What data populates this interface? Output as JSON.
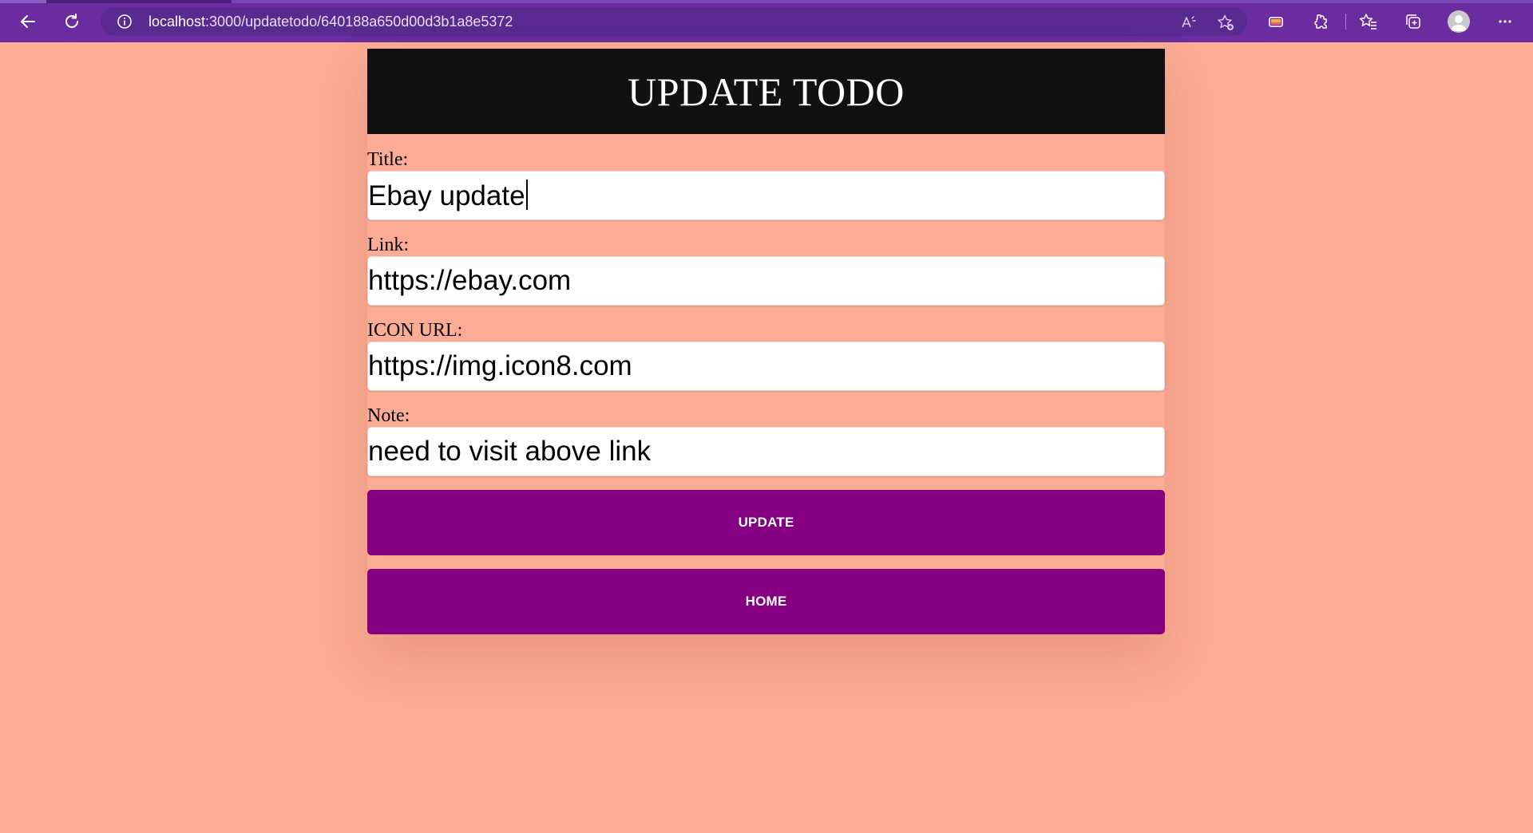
{
  "browser": {
    "url_host": "localhost",
    "url_path": ":3000/updatetodo/640188a650d00d3b1a8e5372",
    "icons": {
      "back": "back-arrow-icon",
      "refresh": "refresh-icon",
      "info": "info-icon",
      "read_aloud": "read-aloud-icon",
      "add_favorite": "add-favorite-icon",
      "extensions": "extensions-icon",
      "favorites": "favorites-icon",
      "collections": "collections-icon",
      "profile": "profile-avatar-icon",
      "more": "more-options-icon"
    }
  },
  "page": {
    "heading": "UPDATE TODO",
    "fields": [
      {
        "label": "Title:",
        "value": "Ebay update"
      },
      {
        "label": "Link:",
        "value": "https://ebay.com"
      },
      {
        "label": "ICON URL:",
        "value": "https://img.icon8.com"
      },
      {
        "label": "Note:",
        "value": "need to visit above link"
      }
    ],
    "buttons": {
      "update": "UPDATE",
      "home": "HOME"
    }
  },
  "colors": {
    "page_background": "#fcab94",
    "browser_chrome": "#6a2c9e",
    "header_background": "#111111",
    "button_background": "#850080",
    "button_text": "#ffffff"
  }
}
